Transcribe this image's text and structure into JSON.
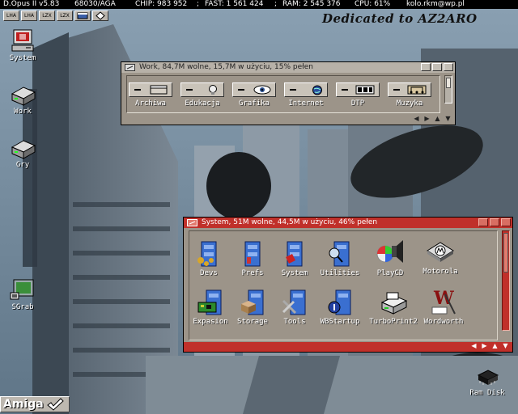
{
  "screen_bar": {
    "app": "D.Opus II v5.83",
    "cpu_type": "68030/AGA",
    "chip": "CHIP: 983 952",
    "sep1": ";",
    "fast": "FAST: 1 561 424",
    "sep2": ";",
    "ram": "RAM: 2 545 376",
    "cpu": "CPU: 61%",
    "email": "kolo.rkm@wp.pl"
  },
  "gadgets": [
    {
      "label": "LHA"
    },
    {
      "label": "LHA"
    },
    {
      "label": "LZX"
    },
    {
      "label": "LZX"
    },
    {
      "label": "",
      "icon": "window-icon"
    },
    {
      "label": "",
      "icon": "diamond-icon"
    }
  ],
  "dedication": "Dedicated to AZ2ARO",
  "desktop_icons": [
    {
      "name": "System",
      "icon": "computer-icon"
    },
    {
      "name": "Work",
      "icon": "harddisk-icon"
    },
    {
      "name": "Gry",
      "icon": "harddisk-icon"
    },
    {
      "name": "SGrab",
      "icon": "screengrab-icon"
    },
    {
      "name": "Ram Disk",
      "icon": "ramdisk-chip-icon"
    }
  ],
  "work_window": {
    "title": "Work, 84,7M wolne, 15,7M w użyciu, 15% pełen",
    "buttons": [
      {
        "label": "Archiwa",
        "icon": "archive-icon"
      },
      {
        "label": "Edukacja",
        "icon": "lightbulb-icon"
      },
      {
        "label": "Grafika",
        "icon": "eye-icon"
      },
      {
        "label": "Internet",
        "icon": "globe-icon"
      },
      {
        "label": "DTP",
        "icon": "dtp-icon"
      },
      {
        "label": "Muzyka",
        "icon": "music-icon"
      }
    ]
  },
  "system_window": {
    "title": "System, 51M wolne, 44,5M w użyciu, 46% pełen",
    "items": [
      {
        "label": "Devs",
        "icon": "drawer-icon"
      },
      {
        "label": "Prefs",
        "icon": "drawer-icon"
      },
      {
        "label": "System",
        "icon": "drawer-icon"
      },
      {
        "label": "Utilities",
        "icon": "drawer-icon"
      },
      {
        "label": "PlayCD",
        "icon": "speaker-icon"
      },
      {
        "label": "Motorola",
        "icon": "motorola-icon"
      },
      {
        "label": "Expasion",
        "icon": "drawer-icon"
      },
      {
        "label": "Storage",
        "icon": "drawer-icon"
      },
      {
        "label": "Tools",
        "icon": "drawer-icon"
      },
      {
        "label": "WBStartup",
        "icon": "drawer-icon"
      },
      {
        "label": "TurboPrint2",
        "icon": "printer-icon"
      },
      {
        "label": "Wordworth",
        "icon": "wordworth-icon"
      }
    ]
  },
  "taskbar": {
    "logo": "Amiga"
  },
  "colors": {
    "screen_bar": "#000000",
    "work_window": "#9c9489",
    "system_titlebar": "#c0302a",
    "drawer_blue": "#3a6fd0"
  }
}
